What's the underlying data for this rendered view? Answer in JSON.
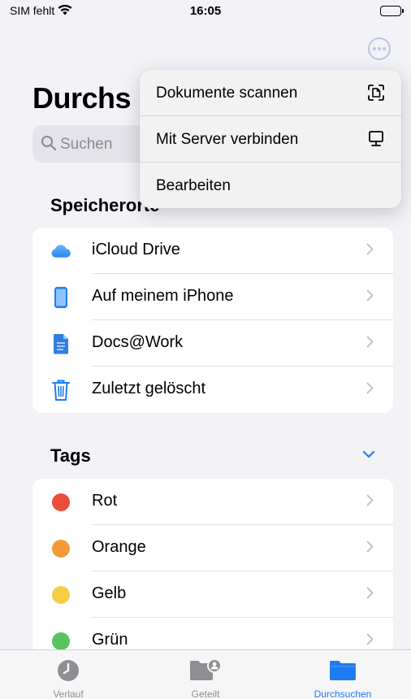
{
  "status_bar": {
    "carrier": "SIM fehlt",
    "time": "16:05"
  },
  "header": {
    "title": "Durchs",
    "more_icon": "ellipsis-circle-icon"
  },
  "search": {
    "placeholder": "Suchen"
  },
  "locations": {
    "header": "Speicherorte",
    "items": [
      {
        "label": "iCloud Drive",
        "icon": "cloud-icon"
      },
      {
        "label": "Auf meinem iPhone",
        "icon": "iphone-icon"
      },
      {
        "label": "Docs@Work",
        "icon": "document-icon"
      },
      {
        "label": "Zuletzt gelöscht",
        "icon": "trash-icon"
      }
    ]
  },
  "tags": {
    "header": "Tags",
    "items": [
      {
        "label": "Rot",
        "color": "#eb4d3d"
      },
      {
        "label": "Orange",
        "color": "#f19a37"
      },
      {
        "label": "Gelb",
        "color": "#f7cd46"
      },
      {
        "label": "Grün",
        "color": "#5ac35f"
      }
    ]
  },
  "menu": {
    "items": [
      {
        "label": "Dokumente scannen",
        "icon": "doc-scan-icon"
      },
      {
        "label": "Mit Server verbinden",
        "icon": "display-icon"
      },
      {
        "label": "Bearbeiten"
      }
    ]
  },
  "tab_bar": {
    "tabs": [
      {
        "label": "Verlauf",
        "icon": "clock-icon",
        "active": false
      },
      {
        "label": "Geteilt",
        "icon": "shared-folder-icon",
        "active": false
      },
      {
        "label": "Durchsuchen",
        "icon": "folder-icon",
        "active": true
      }
    ]
  },
  "colors": {
    "accent": "#1e7cf2",
    "inactive": "#8e8e93",
    "background": "#f2f2f7"
  }
}
